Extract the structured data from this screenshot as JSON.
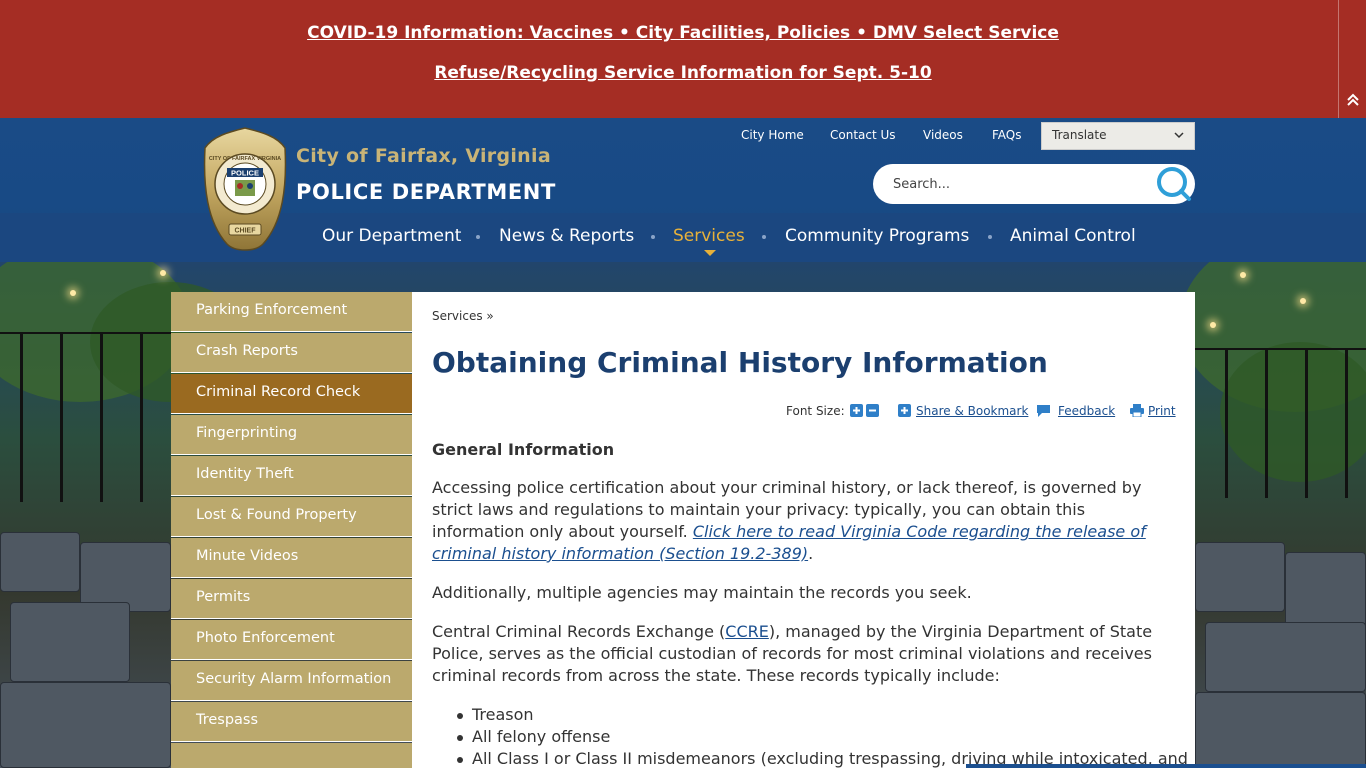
{
  "alert": {
    "line1": "COVID-19 Information: Vaccines • City Facilities, Policies • DMV Select Service",
    "line2": "Refuse/Recycling Service Information for Sept. 5-10"
  },
  "header": {
    "badge_top_text": "CITY OF FAIRFAX VIRGINIA",
    "badge_word": "POLICE",
    "badge_bottom_text": "CHIEF",
    "city_name": "City of Fairfax, Virginia",
    "dept_name": "POLICE DEPARTMENT",
    "utility_links": [
      "City Home",
      "Contact Us",
      "Videos",
      "FAQs"
    ],
    "translate_label": "Translate",
    "search_placeholder": "Search..."
  },
  "nav": {
    "items": [
      "Our Department",
      "News & Reports",
      "Services",
      "Community Programs",
      "Animal Control"
    ],
    "active": "Services"
  },
  "sidebar": {
    "items": [
      "Parking Enforcement",
      "Crash Reports",
      "Criminal Record Check",
      "Fingerprinting",
      "Identity Theft",
      "Lost & Found Property",
      "Minute Videos",
      "Permits",
      "Photo Enforcement",
      "Security Alarm Information",
      "Trespass"
    ],
    "active": "Criminal Record Check"
  },
  "content": {
    "breadcrumb": "Services »",
    "title": "Obtaining Criminal History Information",
    "tools": {
      "font_size": "Font Size:",
      "share": "Share & Bookmark",
      "feedback": "Feedback",
      "print": "Print"
    },
    "section_heading": "General Information",
    "para1_text": "Accessing police certification about your criminal history, or lack thereof, is governed by strict laws and regulations to maintain your privacy: typically, you can obtain this information only about yourself. ",
    "para1_link": "Click here to read Virginia Code regarding the release of criminal history information (Section 19.2-389)",
    "para1_end": ".",
    "para2": "Additionally, multiple agencies may maintain the records you seek.",
    "para3_start": "Central Criminal Records Exchange (",
    "para3_link": "CCRE",
    "para3_end": "), managed by the Virginia Department of State Police, serves as the official custodian of records for most criminal violations and receives criminal records from across the state. These records typically include:",
    "bullets": [
      "Treason",
      "All felony offense",
      "All Class I or Class II misdemeanors (excluding trespassing, driving while intoxicated, and"
    ]
  },
  "colors": {
    "alert_bg": "#a52d24",
    "header_blue": "#1a4b86",
    "accent_gold": "#e7b13a",
    "sidebar_tan": "#bba96d",
    "sidebar_active": "#9a6a20",
    "title_navy": "#1b3f6f"
  }
}
